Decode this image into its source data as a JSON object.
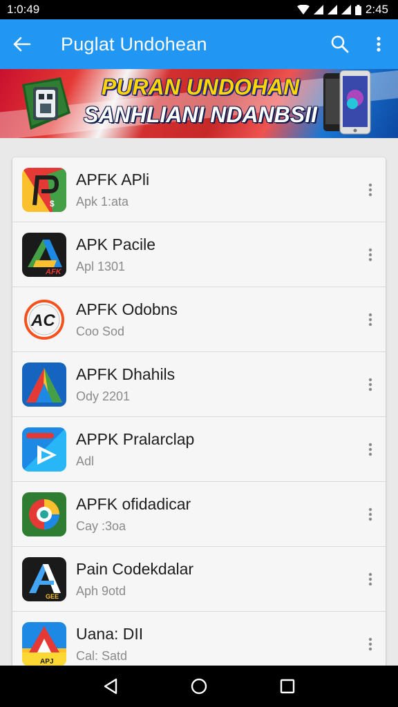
{
  "status_bar": {
    "time_left": "1:0:49",
    "time_right": "2:45"
  },
  "app_bar": {
    "title": "Puglat Undohean"
  },
  "banner": {
    "line1": "PURAN UNDOHAN",
    "line2": "SANHLIANI NDANBSII"
  },
  "apps": [
    {
      "name": "APFK APli",
      "sub": "Apk 1:ata",
      "icon": "red-green-p-icon"
    },
    {
      "name": "APK Pacile",
      "sub": "Apl 1301",
      "icon": "apk-triangle-icon"
    },
    {
      "name": "APFK Odobns",
      "sub": "Coo Sod",
      "icon": "ac-circle-icon"
    },
    {
      "name": "APFK Dhahils",
      "sub": "Ody 2201",
      "icon": "colorful-triangle-icon"
    },
    {
      "name": "APPK Pralarclap",
      "sub": "Adl",
      "icon": "blue-play-icon"
    },
    {
      "name": "APFK ofidadicar",
      "sub": "Cay :3oa",
      "icon": "ring-icon"
    },
    {
      "name": "Pain Codekdalar",
      "sub": "Aph 9otd",
      "icon": "dark-a-icon"
    },
    {
      "name": "Uana: DII",
      "sub": "Cal: Satd",
      "icon": "yellow-a-icon"
    }
  ],
  "colors": {
    "app_bar": "#2196f3",
    "status_bar": "#000000",
    "nav_bar": "#000000"
  }
}
